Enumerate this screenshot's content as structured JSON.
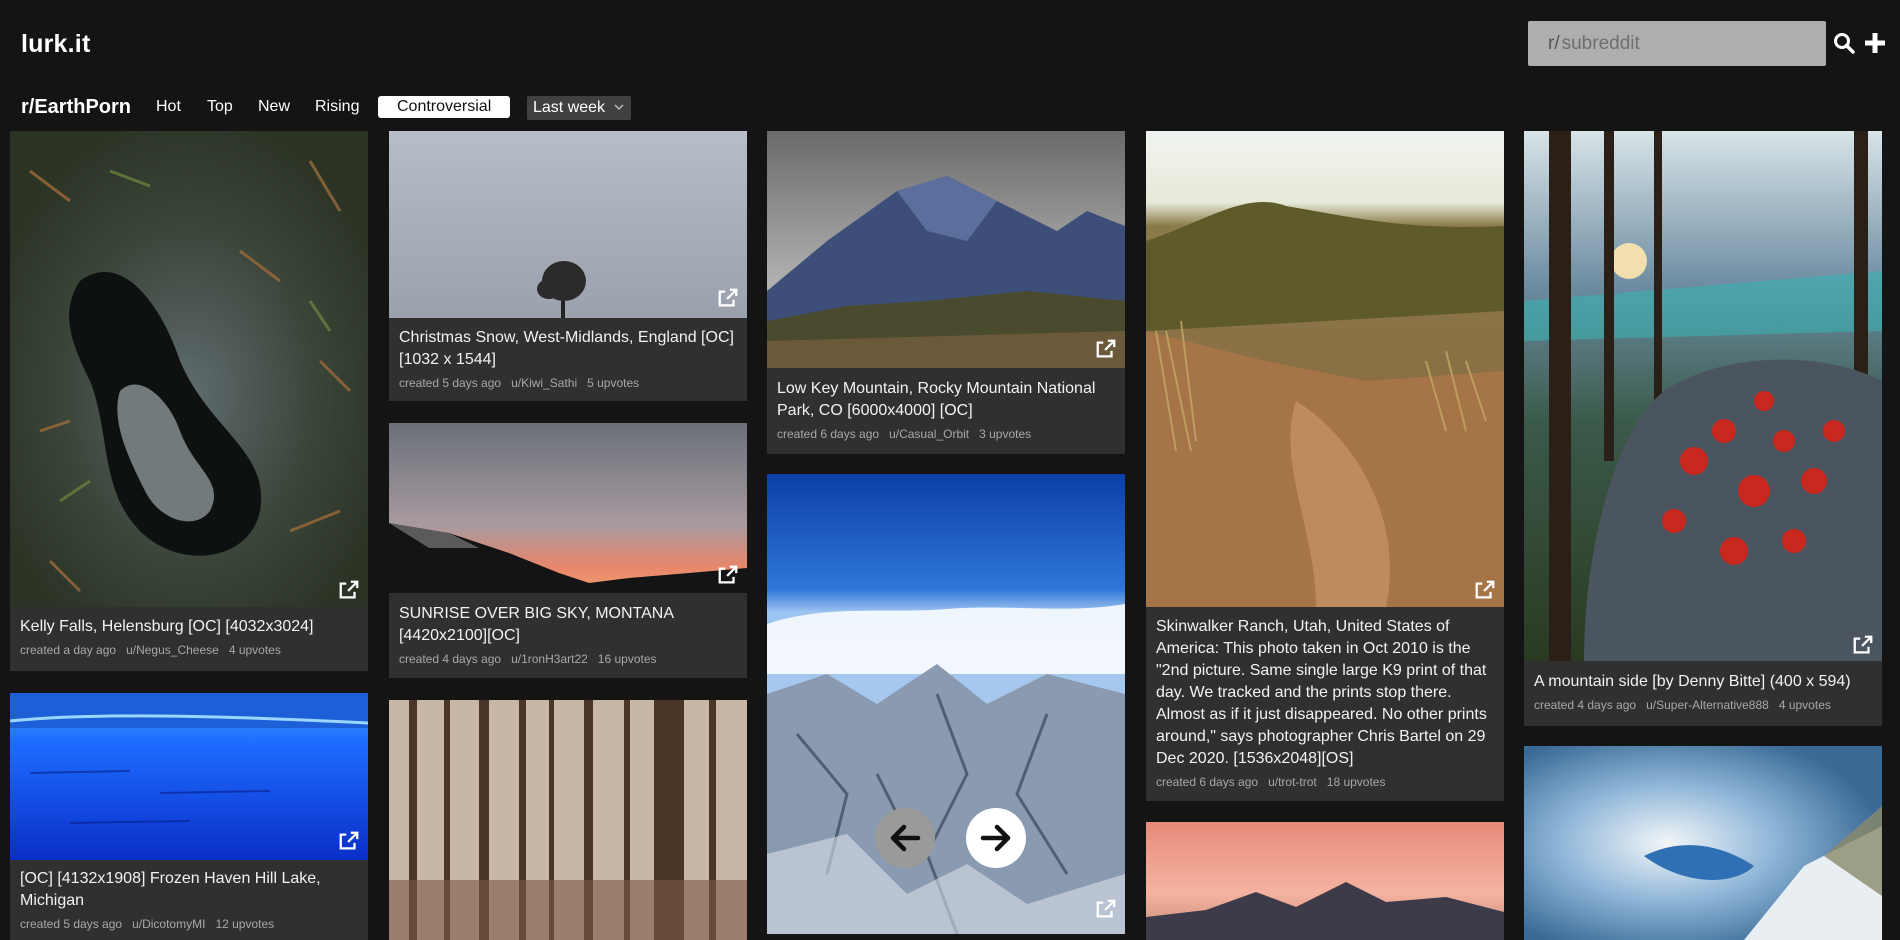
{
  "app": {
    "logo": "lurk.it"
  },
  "search": {
    "prefix": "r/",
    "placeholder": "subreddit",
    "value": ""
  },
  "nav": {
    "subreddit": "r/EarthPorn",
    "tabs": [
      "Hot",
      "Top",
      "New",
      "Rising",
      "Controversial"
    ],
    "active_tab": "Controversial",
    "period": "Last week"
  },
  "posts": [
    {
      "title": "Kelly Falls, Helensburg [OC] [4032x3024]",
      "created": "created a day ago",
      "user": "u/Negus_Cheese",
      "upvotes": "4 upvotes"
    },
    {
      "title": "[OC] [4132x1908] Frozen Haven Hill Lake, Michigan",
      "created": "created 5 days ago",
      "user": "u/DicotomyMI",
      "upvotes": "12 upvotes"
    },
    {
      "title": "Christmas Snow, West-Midlands, England [OC] [1032 x 1544]",
      "created": "created 5 days ago",
      "user": "u/Kiwi_Sathi",
      "upvotes": "5 upvotes"
    },
    {
      "title": "SUNRISE OVER BIG SKY, MONTANA [4420x2100][OC]",
      "created": "created 4 days ago",
      "user": "u/1ronH3art22",
      "upvotes": "16 upvotes"
    },
    {
      "title": "Low Key Mountain, Rocky Mountain National Park, CO [6000x4000] [OC]",
      "created": "created 6 days ago",
      "user": "u/Casual_Orbit",
      "upvotes": "3 upvotes"
    },
    {
      "title": "Skinwalker Ranch, Utah, United States of America: This photo taken in Oct 2010 is the \"2nd picture. Same single large K9 print of that day. We tracked and the prints stop there. Almost as if it just disappeared. No other prints around,\" says photographer Chris Bartel on 29 Dec 2020. [1536x2048][OS]",
      "created": "created 6 days ago",
      "user": "u/trot-trot",
      "upvotes": "18 upvotes"
    },
    {
      "title": "A mountain side [by Denny Bitte] (400 x 594)",
      "created": "created 4 days ago",
      "user": "u/Super-Alternative888",
      "upvotes": "4 upvotes"
    }
  ],
  "gallery": {
    "prev_icon": "arrow-left-icon",
    "next_icon": "arrow-right-icon"
  },
  "icons": {
    "search": "search-icon",
    "add": "plus-icon",
    "external": "external-link-icon"
  },
  "colors": {
    "background": "#141414",
    "card": "#303030",
    "search_bg": "#aeaeae",
    "muted_text": "#a8a8a8"
  }
}
